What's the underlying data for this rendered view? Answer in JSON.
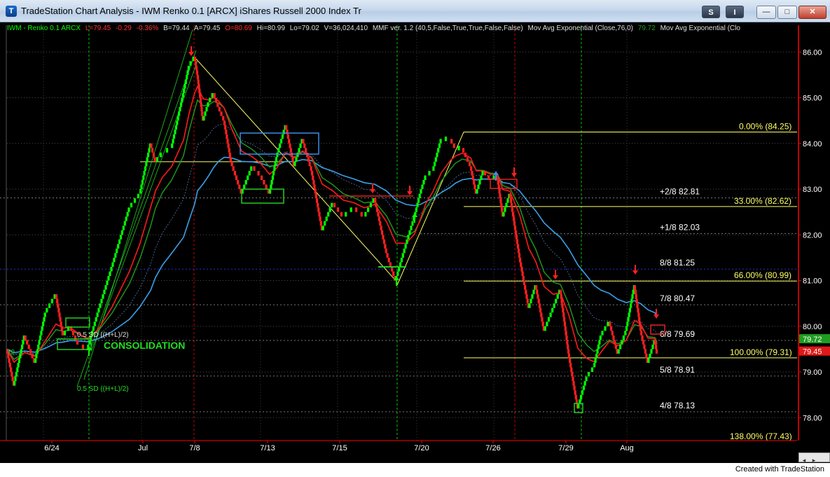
{
  "window": {
    "title": "TradeStation Chart Analysis - IWM Renko 0.1 [ARCX] iShares Russell 2000 Index Tr",
    "buttons": {
      "s_label": "S",
      "i_label": "I",
      "minimize": "—",
      "maximize": "□",
      "close": "✕"
    }
  },
  "info_line": {
    "symbol": "IWM - Renko 0.1  ARCX",
    "last": "L=79.45",
    "change": "-0.29",
    "pct": "-0.36%",
    "bid": "B=79.44",
    "ask": "A=79.45",
    "open": "O=80.69",
    "high": "Hi=80.99",
    "low": "Lo=79.02",
    "volume": "V=36,024,410",
    "indicator1": "MMF ver. 1.2 (40,5,False,True,True,False,False)",
    "indicator2": "Mov Avg Exponential (Close,76,0)",
    "indicator2_value": "79.72",
    "indicator3": "Mov Avg Exponential (Clo"
  },
  "colors": {
    "up": "#00ff00",
    "down": "#ff2020",
    "ema_blue": "#3aa0e8",
    "ema_red": "#ff1a1a",
    "ema_green": "#1f9d1f",
    "fib": "#ffff66",
    "axis": "#ff0000"
  },
  "chart_data": {
    "type": "renko",
    "price_axis": {
      "ylim": [
        77.43,
        86.4
      ],
      "ticks": [
        "86.00",
        "85.00",
        "84.00",
        "83.00",
        "82.00",
        "81.00",
        "80.00",
        "79.00",
        "78.00"
      ]
    },
    "date_labels": [
      "6/24",
      "Jul",
      "7/8",
      "7/13",
      "7/15",
      "7/20",
      "7/26",
      "7/29",
      "Aug"
    ],
    "price_tags": {
      "last": "79.45",
      "ema": "79.72",
      "left_edge": "79."
    },
    "fib_levels": [
      {
        "label": "0.00% (84.25)",
        "price": 84.25
      },
      {
        "label": "33.00% (82.62)",
        "price": 82.62
      },
      {
        "label": "66.00% (80.99)",
        "price": 80.99
      },
      {
        "label": "100.00% (79.31)",
        "price": 79.31
      },
      {
        "label": "138.00% (77.43)",
        "price": 77.43
      }
    ],
    "murrey_levels": [
      {
        "label": "+2/8 82.81",
        "price": 82.81
      },
      {
        "label": "+1/8 82.03",
        "price": 82.03
      },
      {
        "label": "8/8 81.25",
        "price": 81.25
      },
      {
        "label": "7/8 80.47",
        "price": 80.47
      },
      {
        "label": "6/8 79.69",
        "price": 79.69
      },
      {
        "label": "5/8 78.91",
        "price": 78.91
      },
      {
        "label": "4/8 78.13",
        "price": 78.13
      }
    ],
    "annotations": {
      "consolidation": "CONSOLIDATION",
      "sd_upper": "0.5 SD ((H+L)/2)",
      "sd_lower": "0.5 SD ((H+L)/2)"
    },
    "path": [
      [
        10,
        79.5
      ],
      [
        20,
        78.7
      ],
      [
        35,
        79.8
      ],
      [
        50,
        79.2
      ],
      [
        65,
        80.3
      ],
      [
        80,
        80.7
      ],
      [
        90,
        79.8
      ],
      [
        100,
        80.0
      ],
      [
        112,
        79.6
      ],
      [
        125,
        79.5
      ],
      [
        140,
        80.3
      ],
      [
        160,
        81.3
      ],
      [
        185,
        82.6
      ],
      [
        200,
        82.9
      ],
      [
        215,
        84.0
      ],
      [
        222,
        83.6
      ],
      [
        232,
        83.8
      ],
      [
        245,
        83.9
      ],
      [
        262,
        85.1
      ],
      [
        270,
        85.7
      ],
      [
        278,
        85.9
      ],
      [
        282,
        85.5
      ],
      [
        290,
        84.5
      ],
      [
        298,
        84.9
      ],
      [
        305,
        85.1
      ],
      [
        312,
        84.8
      ],
      [
        320,
        84.5
      ],
      [
        330,
        83.6
      ],
      [
        345,
        82.9
      ],
      [
        360,
        83.5
      ],
      [
        372,
        83.3
      ],
      [
        385,
        82.9
      ],
      [
        395,
        83.7
      ],
      [
        408,
        84.4
      ],
      [
        420,
        83.5
      ],
      [
        432,
        84.1
      ],
      [
        445,
        83.4
      ],
      [
        460,
        82.1
      ],
      [
        475,
        82.7
      ],
      [
        490,
        82.4
      ],
      [
        505,
        82.6
      ],
      [
        520,
        82.4
      ],
      [
        535,
        82.8
      ],
      [
        552,
        81.6
      ],
      [
        565,
        81.0
      ],
      [
        580,
        81.8
      ],
      [
        592,
        82.4
      ],
      [
        600,
        82.9
      ],
      [
        608,
        83.3
      ],
      [
        618,
        83.4
      ],
      [
        630,
        84.1
      ],
      [
        643,
        84.1
      ],
      [
        650,
        83.9
      ],
      [
        660,
        83.9
      ],
      [
        672,
        83.5
      ],
      [
        680,
        82.9
      ],
      [
        690,
        83.4
      ],
      [
        700,
        83.2
      ],
      [
        710,
        83.3
      ],
      [
        718,
        82.4
      ],
      [
        728,
        82.9
      ],
      [
        742,
        81.5
      ],
      [
        755,
        80.4
      ],
      [
        765,
        80.9
      ],
      [
        777,
        79.9
      ],
      [
        790,
        80.4
      ],
      [
        800,
        80.8
      ],
      [
        812,
        79.4
      ],
      [
        825,
        78.2
      ],
      [
        838,
        78.9
      ],
      [
        848,
        79.1
      ],
      [
        858,
        79.8
      ],
      [
        870,
        80.1
      ],
      [
        882,
        79.4
      ],
      [
        894,
        79.9
      ],
      [
        906,
        80.9
      ],
      [
        915,
        79.9
      ],
      [
        925,
        79.2
      ],
      [
        935,
        79.7
      ],
      [
        938,
        79.4
      ]
    ]
  }
}
